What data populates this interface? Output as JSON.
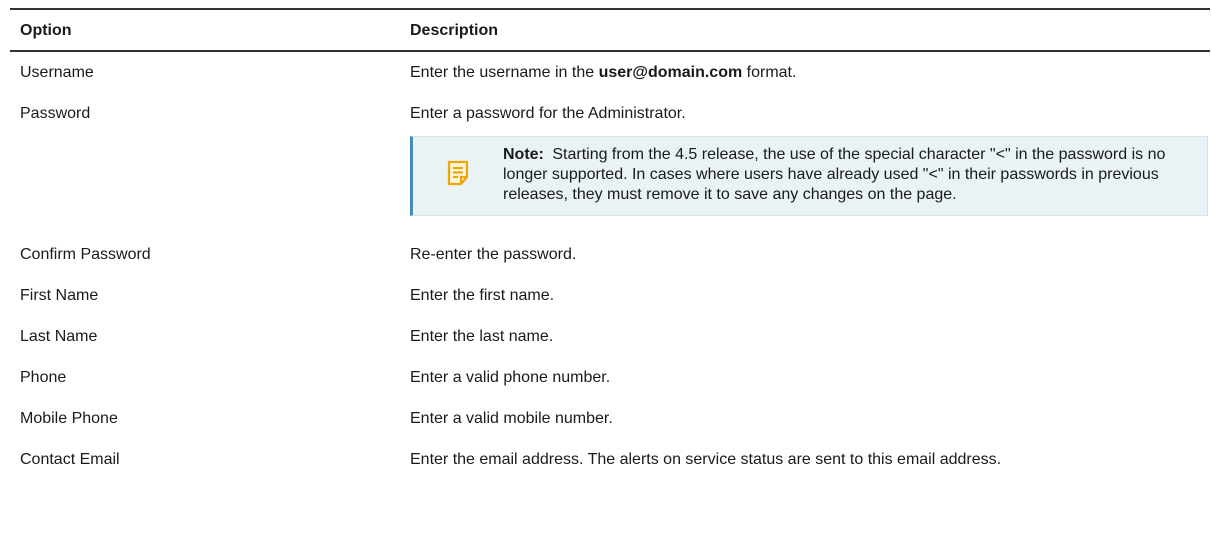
{
  "table": {
    "headers": {
      "option": "Option",
      "description": "Description"
    },
    "rows": [
      {
        "option": "Username",
        "desc_before": "Enter the username in the ",
        "desc_bold": "user@domain.com",
        "desc_after": " format."
      },
      {
        "option": "Password",
        "description": "Enter a password for the Administrator.",
        "note": {
          "label": "Note:",
          "text": "Starting from the 4.5 release, the use of the special character \"<\" in the password is no longer supported. In cases where users have already used \"<\" in their passwords in previous releases, they must remove it to save any changes on the page.",
          "icon": "note-icon"
        }
      },
      {
        "option": "Confirm Password",
        "description": "Re-enter the password."
      },
      {
        "option": "First Name",
        "description": "Enter the first name."
      },
      {
        "option": "Last Name",
        "description": "Enter the last name."
      },
      {
        "option": "Phone",
        "description": "Enter a valid phone number."
      },
      {
        "option": "Mobile Phone",
        "description": "Enter a valid mobile number."
      },
      {
        "option": "Contact Email",
        "description": "Enter the email address. The alerts on service status are sent to this email address."
      }
    ]
  },
  "colors": {
    "note_bg": "#e9f2f5",
    "note_accent": "#3a8fc7",
    "note_icon": "#f0a500"
  }
}
